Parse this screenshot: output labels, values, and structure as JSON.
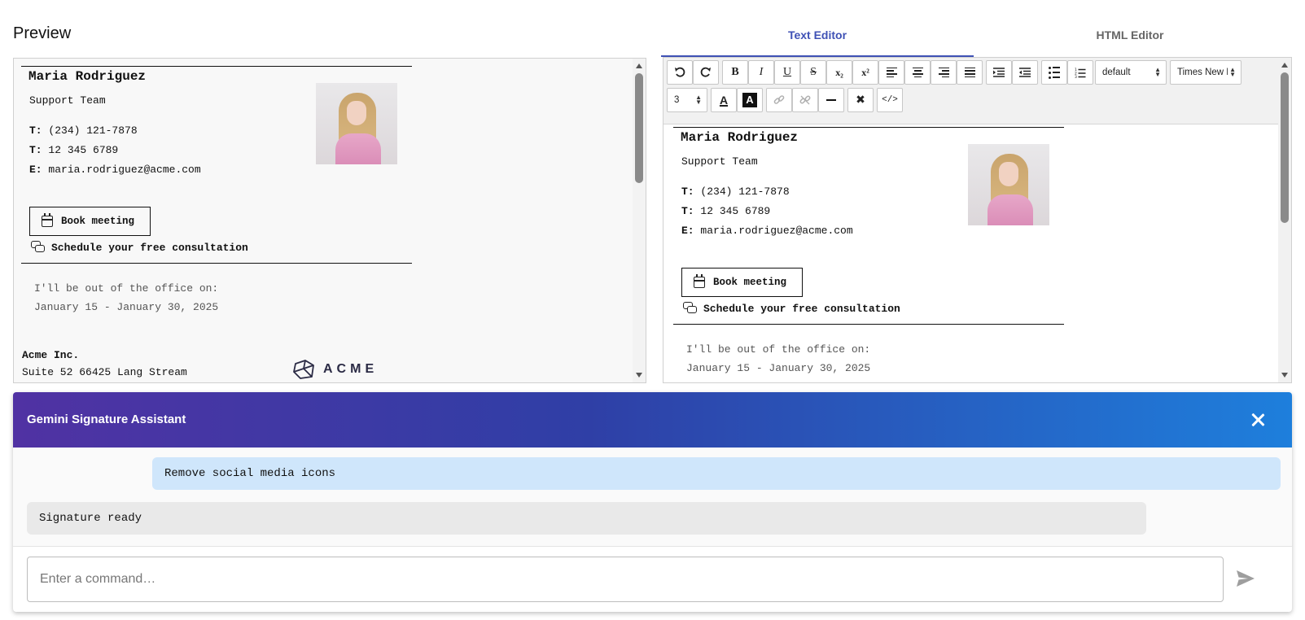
{
  "preview": {
    "title": "Preview"
  },
  "signature": {
    "name": "Maria Rodriguez",
    "team": "Support Team",
    "phone1_label": "T:",
    "phone1": "(234) 121-7878",
    "phone2_label": "T:",
    "phone2": "12 345 6789",
    "email_label": "E:",
    "email": "maria.rodriguez@acme.com",
    "book_label": "Book meeting",
    "consult_label": "Schedule your free consultation",
    "ooo_line1": "I'll be out of the office on:",
    "ooo_line2": "January 15 - January 30, 2025"
  },
  "company": {
    "name": "Acme Inc.",
    "address": "Suite 52 66425 Lang Stream",
    "logo_text": "ACME"
  },
  "editor": {
    "tabs": [
      {
        "label": "Text Editor",
        "active": true
      },
      {
        "label": "HTML Editor",
        "active": false
      }
    ],
    "toolbar": {
      "format_select": "default",
      "font_select": "Times New R",
      "size_select": "3",
      "bold": "B",
      "italic": "I",
      "underline": "U",
      "strike": "S",
      "subscript": "x₂",
      "superscript": "x²",
      "font_color": "A",
      "highlight": "A",
      "source": "</>"
    }
  },
  "assistant": {
    "title": "Gemini Signature Assistant",
    "user_message": "Remove social media icons",
    "bot_message": "Signature ready",
    "input_placeholder": "Enter a command…",
    "header_gradient": [
      "#5032a3",
      "#2f3fa6",
      "#1e7fdc"
    ]
  },
  "colors": {
    "accent": "#3f51b5",
    "user_bubble": "#cfe6fb",
    "bot_bubble": "#e9e9e9"
  }
}
